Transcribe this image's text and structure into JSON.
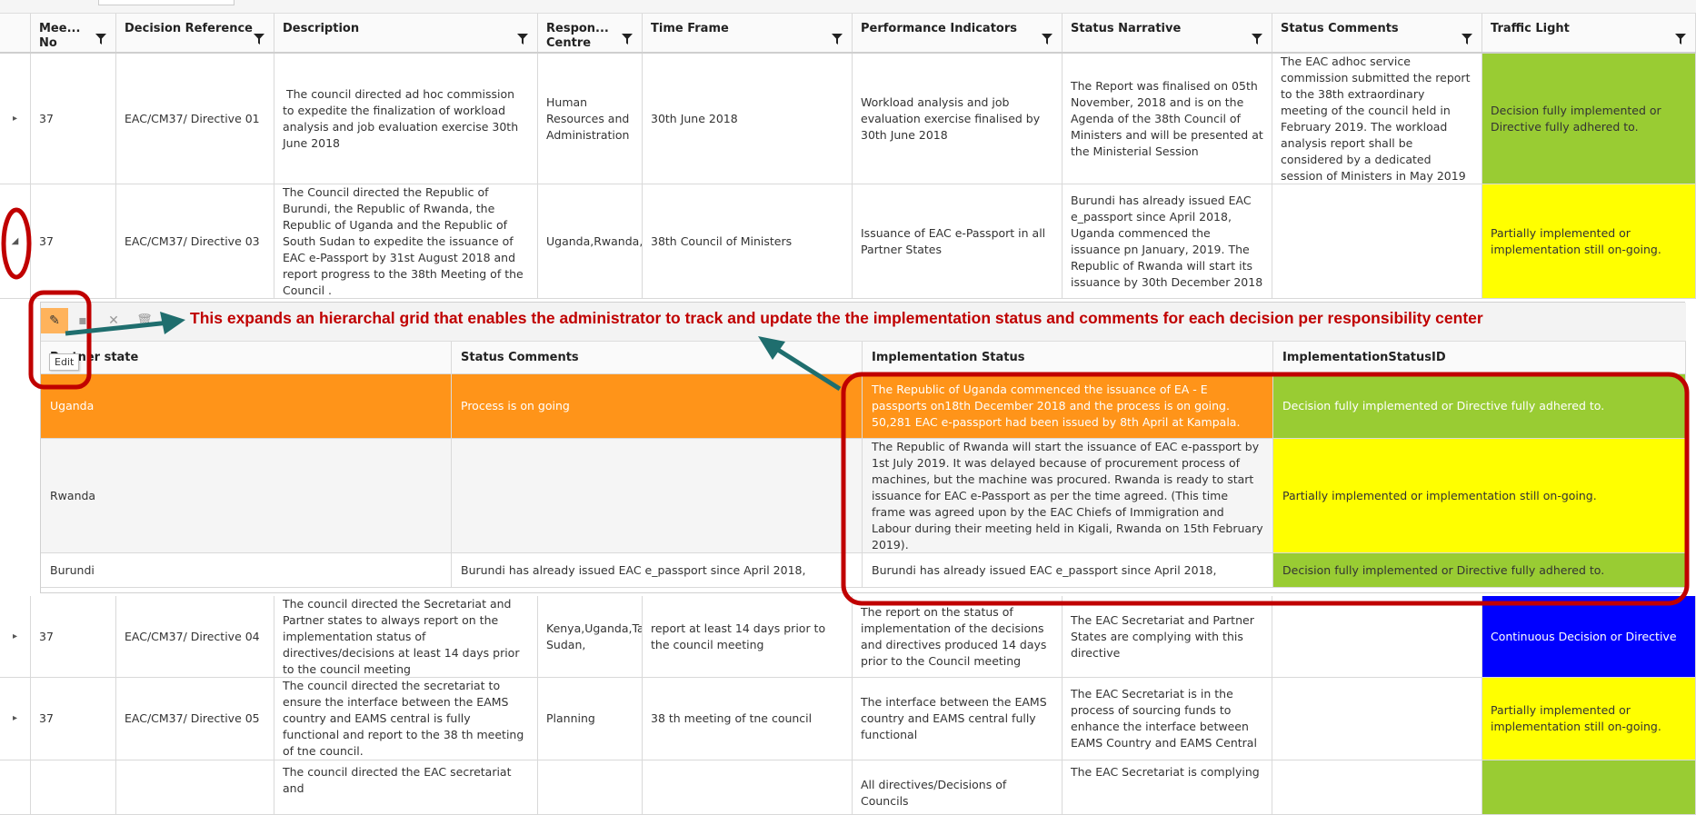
{
  "colors": {
    "green": "#99cc33",
    "yellow": "#ffff00",
    "blue": "#0000ff",
    "orange": "#ff9419",
    "annotation_red": "#c00000",
    "arrow_teal": "#1f6e6e"
  },
  "header": {
    "meeting_no": "Mee...\nNo",
    "decision_reference": "Decision Reference",
    "description": "Description",
    "responsibility_centre": "Respon...\nCentre",
    "time_frame": "Time Frame",
    "performance_indicators": "Performance Indicators",
    "status_narrative": "Status Narrative",
    "status_comments": "Status Comments",
    "traffic_light": "Traffic Light"
  },
  "rows": [
    {
      "meeting_no": "37",
      "decision_reference": "EAC/CM37/ Directive 01",
      "description": " The council directed ad hoc commission to expedite the finalization of workload analysis and job evaluation exercise 30th June 2018",
      "responsibility_centre": "Human Resources and Administration",
      "time_frame": "30th June 2018",
      "performance_indicators": "Workload analysis and job evaluation exercise finalised by 30th June 2018",
      "status_narrative": "The Report was finalised on 05th November, 2018 and is on the Agenda of the 38th Council of Ministers and will be presented at the Ministerial Session",
      "status_comments": "The EAC adhoc service commission submitted the report to the 38th extraordinary meeting of the council held in February 2019. The workload analysis report shall be considered by a dedicated session of Ministers in May 2019",
      "traffic_light": "Decision fully implemented or Directive fully adhered to.",
      "traffic_color": "green"
    },
    {
      "meeting_no": "37",
      "decision_reference": "EAC/CM37/ Directive 03",
      "description": "The Council directed the Republic of Burundi, the Republic of Rwanda, the Republic of Uganda and the Republic of South Sudan to expedite the issuance of EAC e-Passport by 31st August 2018 and report progress to the 38th Meeting of the Council .",
      "responsibility_centre": "Uganda,Rwanda,Bu",
      "time_frame": "38th Council of Ministers",
      "performance_indicators": "Issuance of EAC e-Passport in all Partner States",
      "status_narrative": "Burundi has already issued EAC e_passport since April 2018, Uganda commenced the issuance pn January, 2019. The Republic of Rwanda will start its issuance by 30th December 2018",
      "status_comments": "",
      "traffic_light": "Partially implemented or implementation still on-going.",
      "traffic_color": "yellow"
    },
    {
      "meeting_no": "37",
      "decision_reference": "EAC/CM37/ Directive 04",
      "description": "The council directed the Secretariat and Partner states to always report on the implementation status of directives/decisions at least 14 days prior to the council meeting",
      "responsibility_centre": "Kenya,Uganda,Tan Sudan,",
      "time_frame": "report at least 14 days prior to the council meeting",
      "performance_indicators": "The report on the status of implementation of the decisions and directives produced 14 days prior to the Council meeting",
      "status_narrative": "The EAC Secretariat and Partner States are complying with this directive",
      "status_comments": "",
      "traffic_light": "Continuous Decision or Directive",
      "traffic_color": "blue"
    },
    {
      "meeting_no": "37",
      "decision_reference": "EAC/CM37/ Directive 05",
      "description": "The council directed the secretariat to ensure the interface between the EAMS country and EAMS central is fully functional and report to the 38 th meeting of tne council.",
      "responsibility_centre": "Planning",
      "time_frame": "38 th meeting of tne council",
      "performance_indicators": "The interface between the EAMS country and EAMS central fully functional",
      "status_narrative": "The EAC Secretariat is in the process of sourcing funds to enhance the interface between EAMS Country and EAMS Central",
      "status_comments": "",
      "traffic_light": "Partially implemented or implementation still on-going.",
      "traffic_color": "yellow"
    },
    {
      "meeting_no": "",
      "decision_reference": "",
      "description": "The council directed the EAC secretariat and",
      "responsibility_centre": "",
      "time_frame": "",
      "performance_indicators": "All directives/Decisions of Councils",
      "status_narrative": "The EAC Secretariat is complying",
      "status_comments": "",
      "traffic_light": "",
      "traffic_color": "green"
    }
  ],
  "detail": {
    "tooltip": "Edit",
    "header": {
      "partner_state": "Partner state",
      "status_comments": "Status Comments",
      "implementation_status": "Implementation Status",
      "implementation_status_id": "ImplementationStatusID"
    },
    "rows": [
      {
        "partner_state": "Uganda",
        "status_comments": "Process is on going",
        "implementation_status": "The Republic of Uganda commenced the issuance of EA - E passports on18th December 2018 and the process is on going. 50,281 EAC e-passport had been issued by 8th April at Kampala.",
        "implementation_status_id": "Decision fully implemented or Directive fully adhered to.",
        "id_color": "green"
      },
      {
        "partner_state": "Rwanda",
        "status_comments": "",
        "implementation_status": "The Republic of Rwanda will start the issuance of EAC e-passport by 1st July 2019. It was delayed because of procurement process of machines, but the machine was procured. Rwanda is ready to start issuance for EAC e-Passport as per the time agreed. (This time frame was agreed upon by the EAC Chiefs of Immigration and Labour during their meeting held in Kigali, Rwanda on 15th February 2019).",
        "implementation_status_id": "Partially implemented or implementation still on-going.",
        "id_color": "yellow"
      },
      {
        "partner_state": "Burundi",
        "status_comments": "Burundi has already issued EAC e_passport since April 2018,",
        "implementation_status": "Burundi has already issued EAC e_passport since April 2018,",
        "implementation_status_id": "Decision fully implemented or Directive fully adhered to.",
        "id_color": "green"
      }
    ]
  },
  "annotation": {
    "text": "This expands an hierarchal grid that enables the administrator to track and update the the implementation status and comments for each decision per responsibility center"
  }
}
